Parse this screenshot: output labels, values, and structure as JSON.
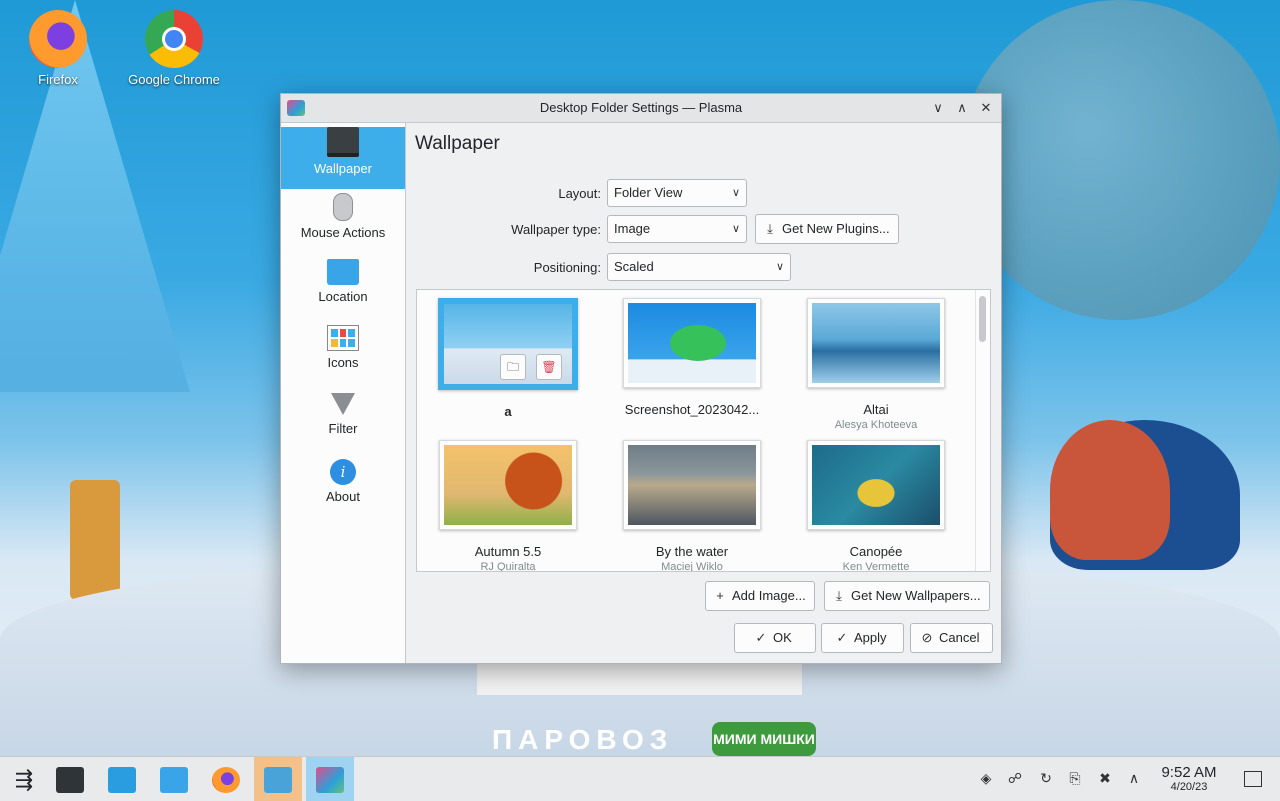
{
  "desktop": {
    "icons": [
      {
        "label": "Firefox",
        "icon": "firefox-icon"
      },
      {
        "label": "Google Chrome",
        "icon": "chrome-icon"
      }
    ],
    "wallpaper_text": "ПАРОВОЗ",
    "wallpaper_logo": "МИМИ МИШКИ"
  },
  "dialog": {
    "title": "Desktop Folder Settings — Plasma",
    "titlebar_buttons": {
      "minimize": "∨",
      "maximize": "∧",
      "close": "✕"
    },
    "sidebar": [
      {
        "label": "Wallpaper",
        "icon": "monitor-icon",
        "active": true
      },
      {
        "label": "Mouse Actions",
        "icon": "mouse-icon"
      },
      {
        "label": "Location",
        "icon": "folder-icon"
      },
      {
        "label": "Icons",
        "icon": "icons-grid-icon"
      },
      {
        "label": "Filter",
        "icon": "filter-icon"
      },
      {
        "label": "About",
        "icon": "info-icon"
      }
    ],
    "page_title": "Wallpaper",
    "layout": {
      "label": "Layout:",
      "value": "Folder View"
    },
    "wallpaper_type": {
      "label": "Wallpaper type:",
      "value": "Image"
    },
    "get_new_plugins": "Get New Plugins...",
    "positioning": {
      "label": "Positioning:",
      "value": "Scaled"
    },
    "wallpapers": [
      {
        "name": "a",
        "author": "",
        "selected": true
      },
      {
        "name": "Screenshot_2023042...",
        "author": ""
      },
      {
        "name": "Altai",
        "author": "Alesya Khoteeva"
      },
      {
        "name": "Autumn 5.5",
        "author": "RJ Quiralta"
      },
      {
        "name": "By the water",
        "author": "Maciej Wiklo"
      },
      {
        "name": "Canopée",
        "author": "Ken Vermette"
      }
    ],
    "add_image": "Add Image...",
    "get_new_wallpapers": "Get New Wallpapers...",
    "ok": "OK",
    "apply": "Apply",
    "cancel": "Cancel"
  },
  "taskbar": {
    "items": [
      "application-launcher-icon",
      "system-settings-icon",
      "discover-store-icon",
      "dolphin-files-icon",
      "firefox-icon",
      "kinfocenter-icon",
      "plasma-settings-icon"
    ],
    "tray": [
      "vault-icon",
      "kde-connect-icon",
      "updates-icon",
      "clipboard-icon",
      "volume-muted-icon",
      "expand-tray-icon"
    ],
    "time": "9:52 AM",
    "date": "4/20/23"
  },
  "colors": {
    "accent": "#3daee9",
    "window_bg": "#eff0f1",
    "taskbar_bg": "#e9eaec"
  }
}
